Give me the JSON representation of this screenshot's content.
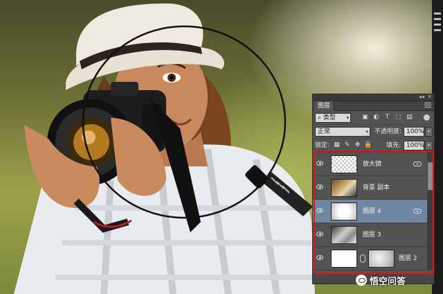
{
  "panel": {
    "tab": "图层",
    "filter_kind": "类型",
    "blend_mode": "正常",
    "opacity_label": "不透明度:",
    "opacity_value": "100%",
    "lock_label": "锁定:",
    "fill_label": "填充:",
    "fill_value": "100%"
  },
  "layers": [
    {
      "name": "放大镜",
      "thumb": "checker",
      "visible": true,
      "selected": false,
      "linked": true
    },
    {
      "name": "背景 副本",
      "thumb": "photo",
      "visible": true,
      "selected": false,
      "linked": false
    },
    {
      "name": "图层 4",
      "thumb": "glow",
      "visible": true,
      "selected": true,
      "linked": true
    },
    {
      "name": "图层 3",
      "thumb": "gray",
      "visible": true,
      "selected": false,
      "linked": false
    },
    {
      "name": "图层 2",
      "thumb": "white",
      "visible": true,
      "selected": false,
      "linked": false,
      "has_mask": true
    }
  ],
  "watermark": {
    "text": "悟空问答"
  },
  "colors": {
    "highlight": "#e0141b",
    "selected_row": "#6f87a3",
    "panel_bg": "#535353"
  }
}
